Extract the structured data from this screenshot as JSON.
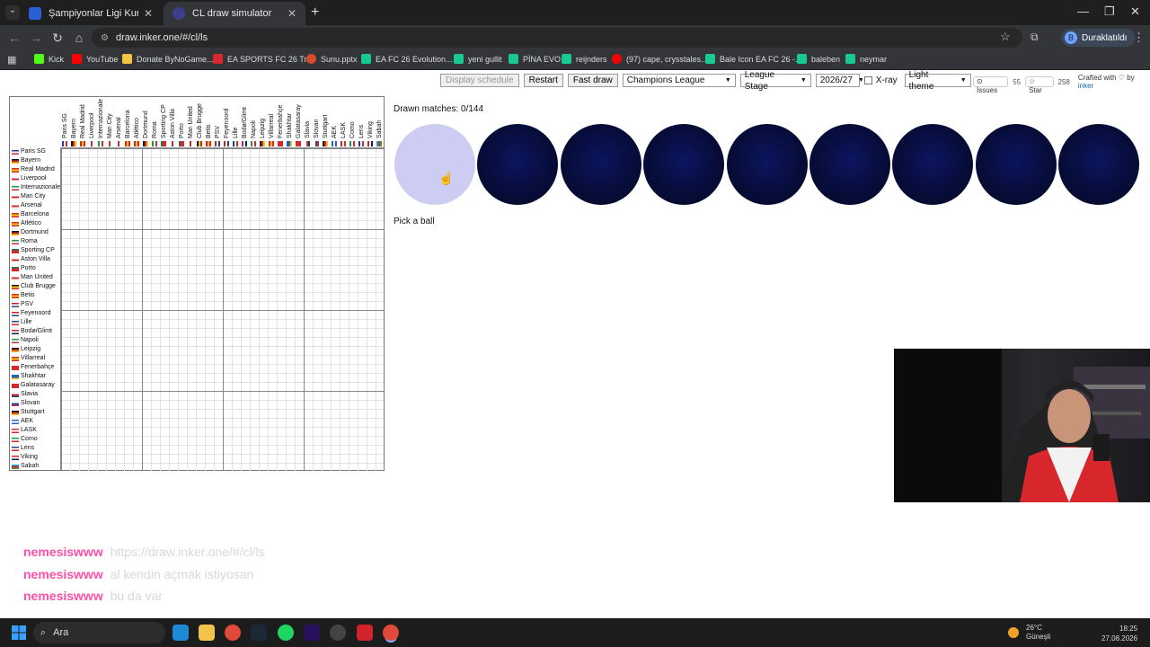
{
  "browser": {
    "tabs": [
      {
        "title": "Şampiyonlar Ligi Kura Simülatö",
        "active": false
      },
      {
        "title": "CL draw simulator",
        "active": true
      }
    ],
    "url": "draw.inker.one/#/cl/ls",
    "profile": {
      "initial": "B",
      "label": "Duraklatıldı"
    },
    "bookmarks": [
      "Kick",
      "YouTube",
      "Donate ByNoGame...",
      "EA SPORTS FC 26 Tr...",
      "Sunu.pptx",
      "EA FC 26 Evolution...",
      "yeni gullit",
      "PİNA EVO",
      "reijnders",
      "(97) cape, crysstales...",
      "Bale Icon EA FC 26 -...",
      "baleben",
      "neymar"
    ]
  },
  "controls": {
    "display_schedule": "Display schedule",
    "restart": "Restart",
    "fast_draw": "Fast draw",
    "competition": "Champions League",
    "stage": "League Stage",
    "season": "2026/27",
    "xray": "X-ray",
    "theme": "Light theme",
    "issues_label": "Issues",
    "issues_count": "55",
    "star_label": "Star",
    "star_count": "258",
    "crafted_prefix": "Crafted with ♡ by",
    "crafted_author": "inker"
  },
  "teams": [
    {
      "name": "Paris SG",
      "flag": "fr"
    },
    {
      "name": "Bayern",
      "flag": "de"
    },
    {
      "name": "Real Madrid",
      "flag": "es"
    },
    {
      "name": "Liverpool",
      "flag": "en"
    },
    {
      "name": "Internazionale",
      "flag": "it"
    },
    {
      "name": "Man City",
      "flag": "en"
    },
    {
      "name": "Arsenal",
      "flag": "en"
    },
    {
      "name": "Barcelona",
      "flag": "es"
    },
    {
      "name": "Atlético",
      "flag": "es"
    },
    {
      "name": "Dortmund",
      "flag": "de"
    },
    {
      "name": "Roma",
      "flag": "it"
    },
    {
      "name": "Sporting CP",
      "flag": "pt"
    },
    {
      "name": "Aston Villa",
      "flag": "en"
    },
    {
      "name": "Porto",
      "flag": "pt"
    },
    {
      "name": "Man United",
      "flag": "en"
    },
    {
      "name": "Club Brugge",
      "flag": "be"
    },
    {
      "name": "Betis",
      "flag": "es"
    },
    {
      "name": "PSV",
      "flag": "nl"
    },
    {
      "name": "Feyenoord",
      "flag": "nl"
    },
    {
      "name": "Lille",
      "flag": "fr"
    },
    {
      "name": "Bodø/Glimt",
      "flag": "no"
    },
    {
      "name": "Napoli",
      "flag": "it"
    },
    {
      "name": "Leipzig",
      "flag": "de"
    },
    {
      "name": "Villarreal",
      "flag": "es"
    },
    {
      "name": "Fenerbahçe",
      "flag": "tr"
    },
    {
      "name": "Shakhtar",
      "flag": "ua"
    },
    {
      "name": "Galatasaray",
      "flag": "tr"
    },
    {
      "name": "Slavia",
      "flag": "cz"
    },
    {
      "name": "Slovan",
      "flag": "sk"
    },
    {
      "name": "Stuttgart",
      "flag": "de"
    },
    {
      "name": "AEK",
      "flag": "gr"
    },
    {
      "name": "LASK",
      "flag": "at"
    },
    {
      "name": "Como",
      "flag": "it"
    },
    {
      "name": "Lens",
      "flag": "fr"
    },
    {
      "name": "Viking",
      "flag": "no"
    },
    {
      "name": "Sabah",
      "flag": "az"
    }
  ],
  "draw": {
    "status": "Drawn matches: 0/144",
    "prompt": "Pick a ball",
    "ball_count": 9,
    "selected_ball": 0
  },
  "chat": [
    {
      "user": "nemesiswww",
      "message": "https://draw.inker.one/#/cl/ls"
    },
    {
      "user": "nemesiswww",
      "message": "al kendin açmak istiyosan"
    },
    {
      "user": "nemesiswww",
      "message": "bu da var"
    }
  ],
  "taskbar": {
    "search_placeholder": "Ara",
    "temperature": "26°C",
    "weather": "Güneşli",
    "time": "18:25",
    "date": "27.08.2026"
  },
  "colors": {
    "ball_dark": "#070d3a",
    "ball_selected": "#cdcdf3",
    "chat_user": "#ff4fa8",
    "author_link": "#1166aa"
  }
}
